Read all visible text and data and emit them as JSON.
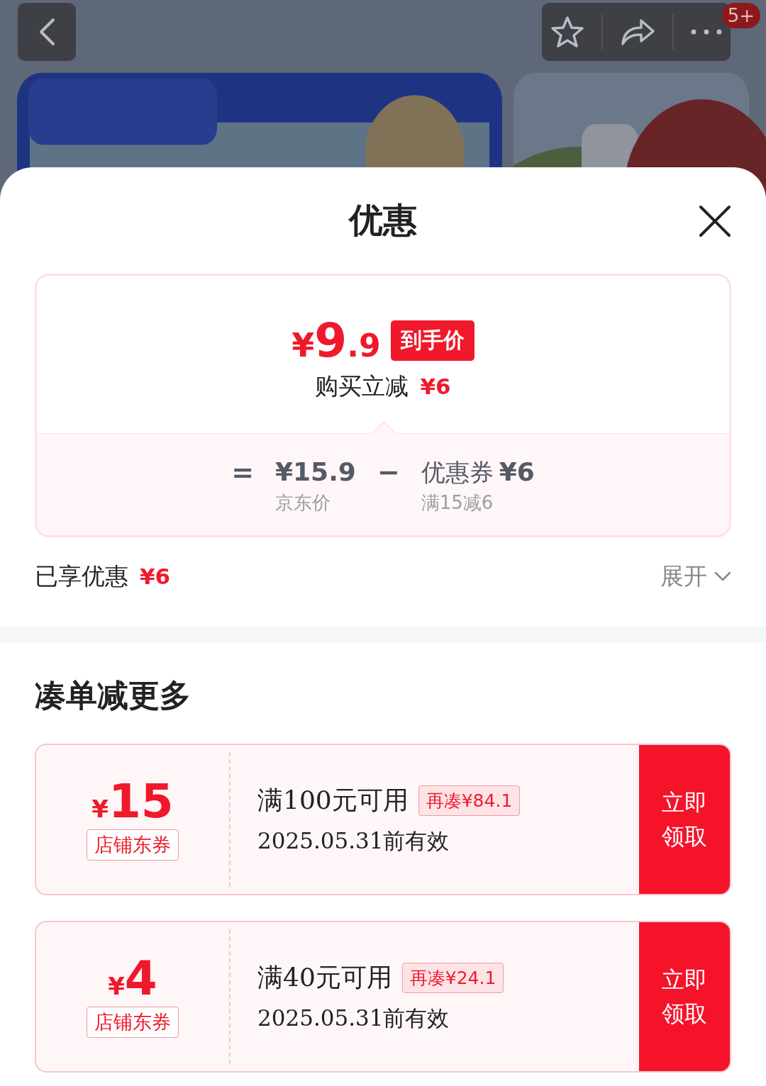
{
  "header": {
    "badge": "5+"
  },
  "sheet": {
    "title": "优惠"
  },
  "price_card": {
    "currency": "¥",
    "amount": "9",
    "decimal": ".9",
    "tag": "到手价",
    "saving_label": "购买立减",
    "saving_amount": "¥6",
    "formula": [
      {
        "kind": "operator",
        "text": "="
      },
      {
        "kind": "term",
        "value": "¥15.9",
        "caption": "京东价"
      },
      {
        "kind": "operator",
        "text": "−"
      },
      {
        "kind": "term",
        "label": "优惠券",
        "value": "¥6",
        "caption": "满15减6"
      }
    ]
  },
  "summary": {
    "label": "已享优惠",
    "amount": "¥6",
    "toggle": "展开",
    "expanded": false
  },
  "section": {
    "title": "凑单减更多"
  },
  "coupons": [
    {
      "currency": "¥",
      "amount": "15",
      "type": "店铺东券",
      "condition": "满100元可用",
      "gap": "再凑¥84.1",
      "validity": "2025.05.31前有效",
      "button_lines": [
        "立即",
        "领取"
      ]
    },
    {
      "currency": "¥",
      "amount": "4",
      "type": "店铺东券",
      "condition": "满40元可用",
      "gap": "再凑¥24.1",
      "validity": "2025.05.31前有效",
      "button_lines": [
        "立即",
        "领取"
      ]
    }
  ]
}
